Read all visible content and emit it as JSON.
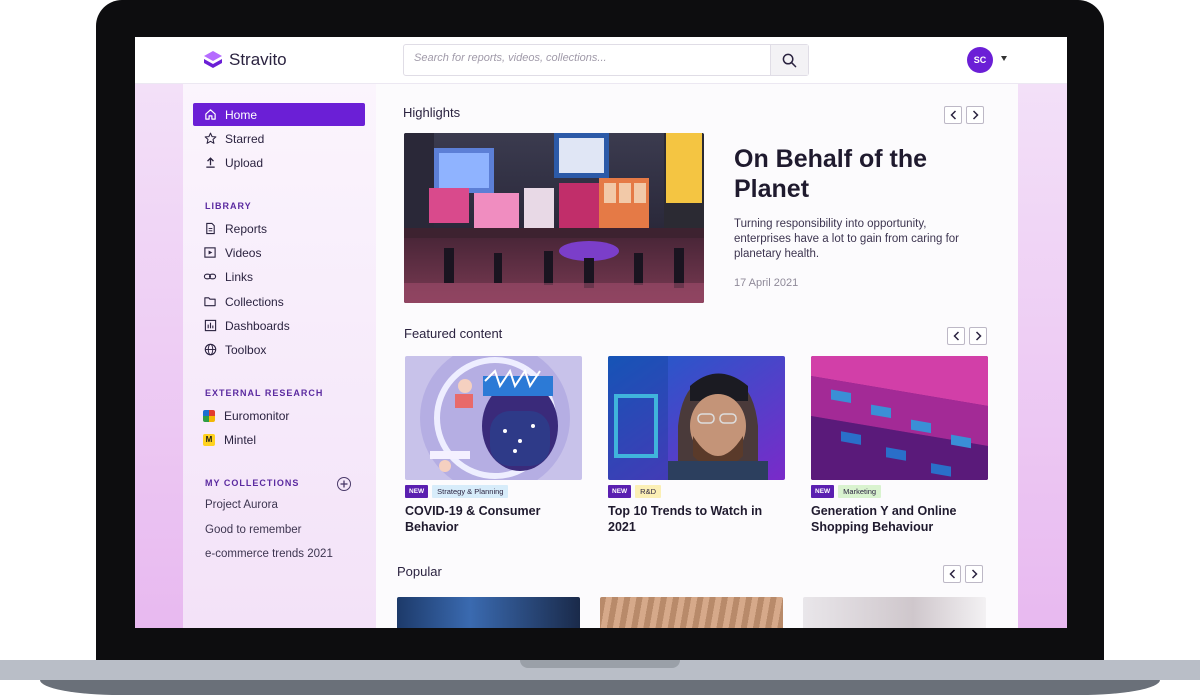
{
  "app": {
    "name": "Stravito",
    "brand_color": "#6b1fd6"
  },
  "header": {
    "search_placeholder": "Search for reports, videos, collections...",
    "search_icon": "search-icon",
    "avatar_initials": "SC"
  },
  "sidebar": {
    "main_items": [
      {
        "label": "Home",
        "icon": "home-icon",
        "active": true
      },
      {
        "label": "Starred",
        "icon": "star-icon"
      },
      {
        "label": "Upload",
        "icon": "upload-icon"
      }
    ],
    "library_label": "LIBRARY",
    "library_items": [
      {
        "label": "Reports",
        "icon": "document-icon"
      },
      {
        "label": "Videos",
        "icon": "video-icon"
      },
      {
        "label": "Links",
        "icon": "link-icon"
      },
      {
        "label": "Collections",
        "icon": "folder-icon"
      },
      {
        "label": "Dashboards",
        "icon": "dashboard-icon"
      },
      {
        "label": "Toolbox",
        "icon": "globe-icon"
      }
    ],
    "external_label": "EXTERNAL RESEARCH",
    "external_items": [
      {
        "label": "Euromonitor",
        "icon": "euromonitor-logo"
      },
      {
        "label": "Mintel",
        "icon": "mintel-logo",
        "icon_text": "M"
      }
    ],
    "collections_label": "MY COLLECTIONS",
    "collections": [
      "Project Aurora",
      "Good to remember",
      "e-commerce trends 2021"
    ]
  },
  "highlights": {
    "title": "Highlights",
    "item": {
      "title": "On Behalf of the Planet",
      "description": "Turning responsibility into opportunity, enterprises have a lot to gain from caring for planetary health.",
      "date": "17 April 2021"
    }
  },
  "featured": {
    "title": "Featured content",
    "cards": [
      {
        "badge": "NEW",
        "tag": "Strategy & Planning",
        "tag_color": "#d7ecfa",
        "title": "COVID-19 & Consumer Behavior"
      },
      {
        "badge": "NEW",
        "tag": "R&D",
        "tag_color": "#fbefb5",
        "title": "Top 10 Trends to Watch in 2021"
      },
      {
        "badge": "NEW",
        "tag": "Marketing",
        "tag_color": "#d9f3cf",
        "title": "Generation Y and Online Shopping Behaviour"
      }
    ]
  },
  "popular": {
    "title": "Popular"
  }
}
